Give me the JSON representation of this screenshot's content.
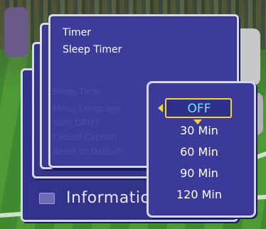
{
  "main_menu": {
    "title_lines": [
      "Timer",
      "Sleep Timer"
    ],
    "ghost_items": [
      "Sleep Time",
      "Menu Language",
      "Auto DPMS",
      "Closed Caption",
      "Reset to Default"
    ]
  },
  "info_bar": {
    "label": "Informatio"
  },
  "sleep_popup": {
    "selected_index": 0,
    "options": [
      "OFF",
      "30 Min",
      "60 Min",
      "90 Min",
      "120 Min"
    ]
  },
  "colors": {
    "menu_bg": "#3d3c9b",
    "border": "#d7d7f0",
    "highlight": "#f0d23a",
    "selected_text": "#6fe8ff"
  }
}
